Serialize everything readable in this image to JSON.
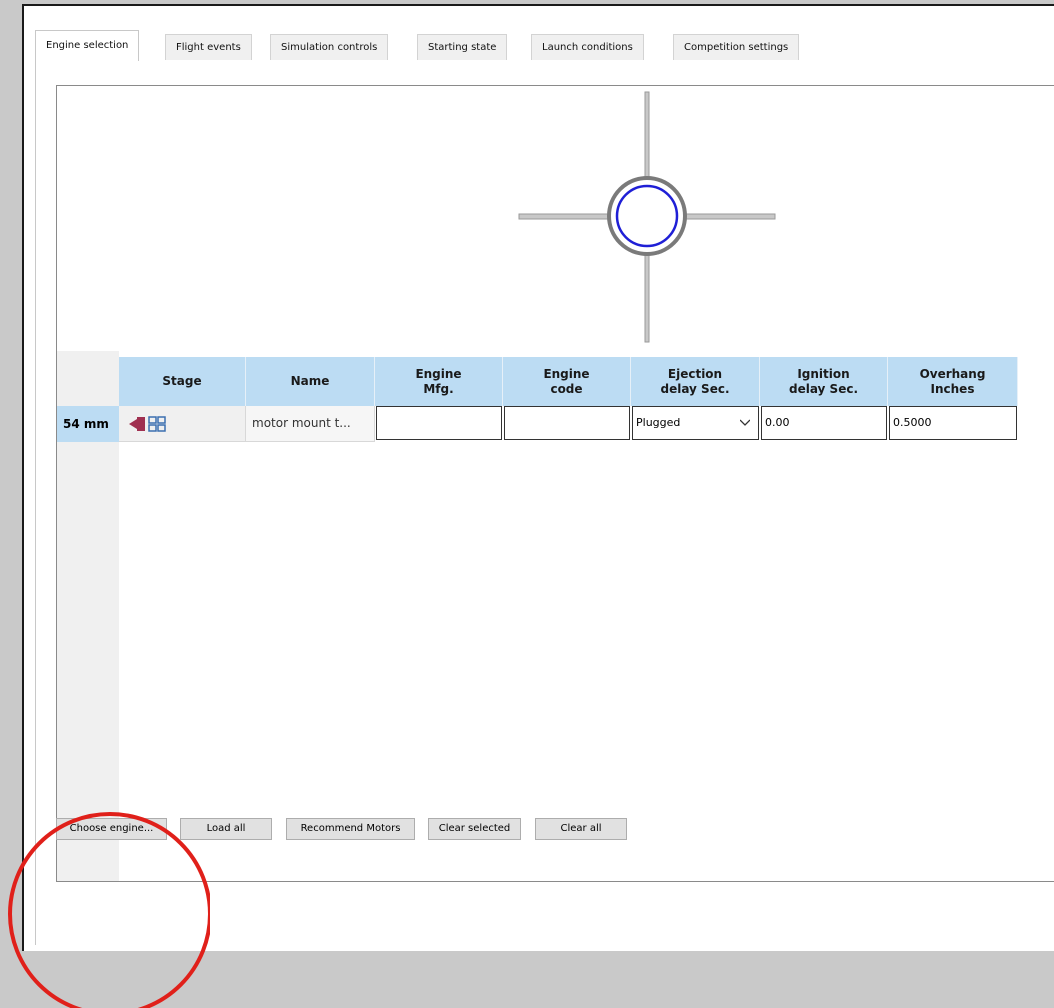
{
  "tabs": [
    {
      "label": "Engine selection",
      "active": true
    },
    {
      "label": "Flight events"
    },
    {
      "label": "Simulation controls"
    },
    {
      "label": "Starting state"
    },
    {
      "label": "Launch conditions"
    },
    {
      "label": "Competition settings"
    }
  ],
  "table": {
    "headers": {
      "stage": "Stage",
      "name": "Name",
      "engine_mfg": "Engine\nMfg.",
      "engine_code": "Engine\ncode",
      "ejection_delay": "Ejection\ndelay Sec.",
      "ignition_delay": "Ignition\ndelay Sec.",
      "overhang": "Overhang\nInches"
    },
    "rows": [
      {
        "label": "54 mm",
        "name": "motor mount t...",
        "engine_mfg": "",
        "engine_code": "",
        "ejection_delay": "Plugged",
        "ignition_delay": "0.00",
        "overhang": "0.5000"
      }
    ]
  },
  "buttons": {
    "choose_engine": "Choose engine...",
    "load_all": "Load all",
    "recommend": "Recommend Motors",
    "clear_selected": "Clear selected",
    "clear_all": "Clear all"
  },
  "colors": {
    "header_blue": "#bcdcf3",
    "ring_outer": "#7a7a7a",
    "ring_inner": "#1f1fd6",
    "annotation_red": "#e0201a"
  }
}
